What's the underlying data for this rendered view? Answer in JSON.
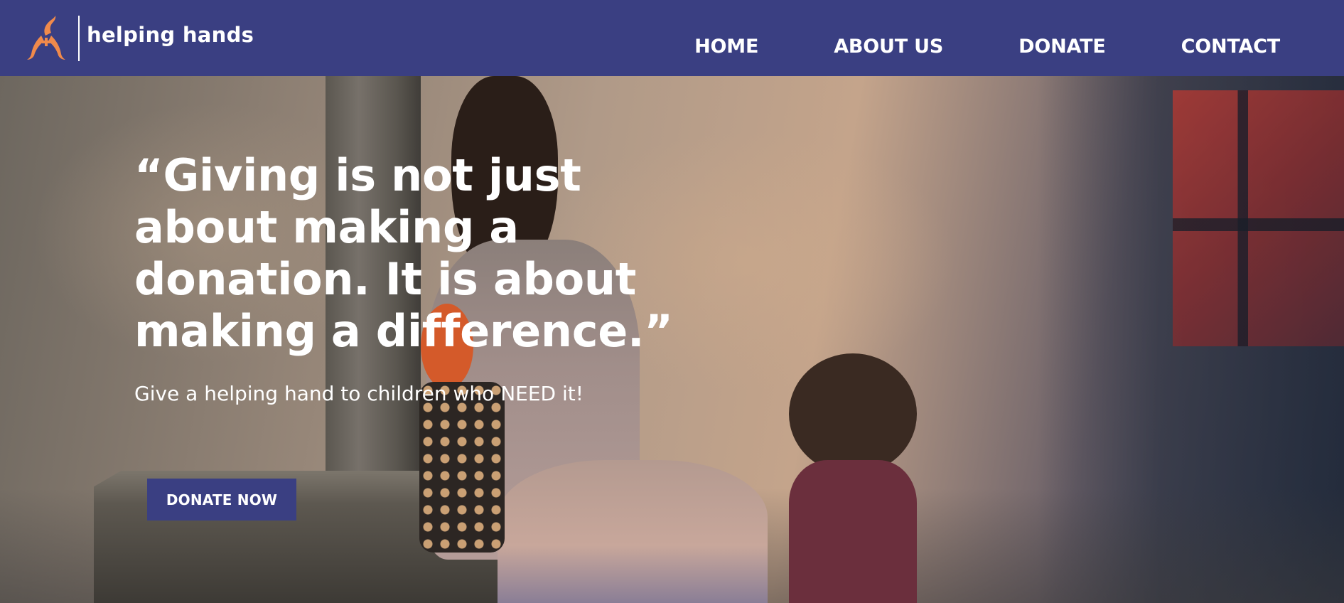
{
  "brand": {
    "name": "helping hands",
    "logo_icon": "helping-hands-logo-icon"
  },
  "nav": {
    "items": [
      {
        "label": "HOME"
      },
      {
        "label": "ABOUT US"
      },
      {
        "label": "DONATE"
      },
      {
        "label": "CONTACT"
      }
    ]
  },
  "hero": {
    "quote": "“Giving is not just about making a donation. It is about making a difference.”",
    "subtitle": "Give a helping hand to children who NEED it!",
    "cta_label": "DONATE NOW"
  },
  "colors": {
    "header_background": "#3a3f82",
    "button_background": "#3a3f82",
    "logo_accent": "#f08a4b",
    "text": "#ffffff"
  }
}
